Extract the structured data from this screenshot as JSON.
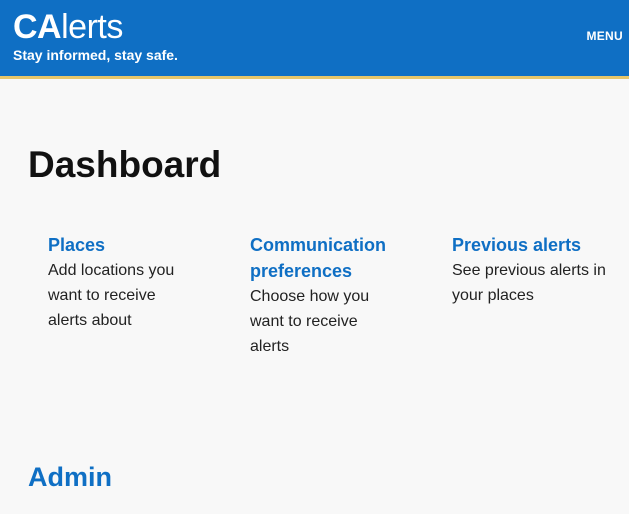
{
  "header": {
    "logo_bold": "CA",
    "logo_light": "lerts",
    "tagline": "Stay informed, stay safe.",
    "menu_label": "MENU"
  },
  "main": {
    "title": "Dashboard",
    "cards": [
      {
        "title": "Places",
        "description": "Add locations you want to receive alerts about"
      },
      {
        "title": "Communication preferences",
        "description": "Choose how you want to receive alerts"
      },
      {
        "title": "Previous alerts",
        "description": "See previous alerts in your places"
      }
    ],
    "admin_heading": "Admin"
  },
  "colors": {
    "brand_blue": "#0f6fc4",
    "accent_gold": "#e7c66a",
    "background": "#f8f8f8"
  }
}
